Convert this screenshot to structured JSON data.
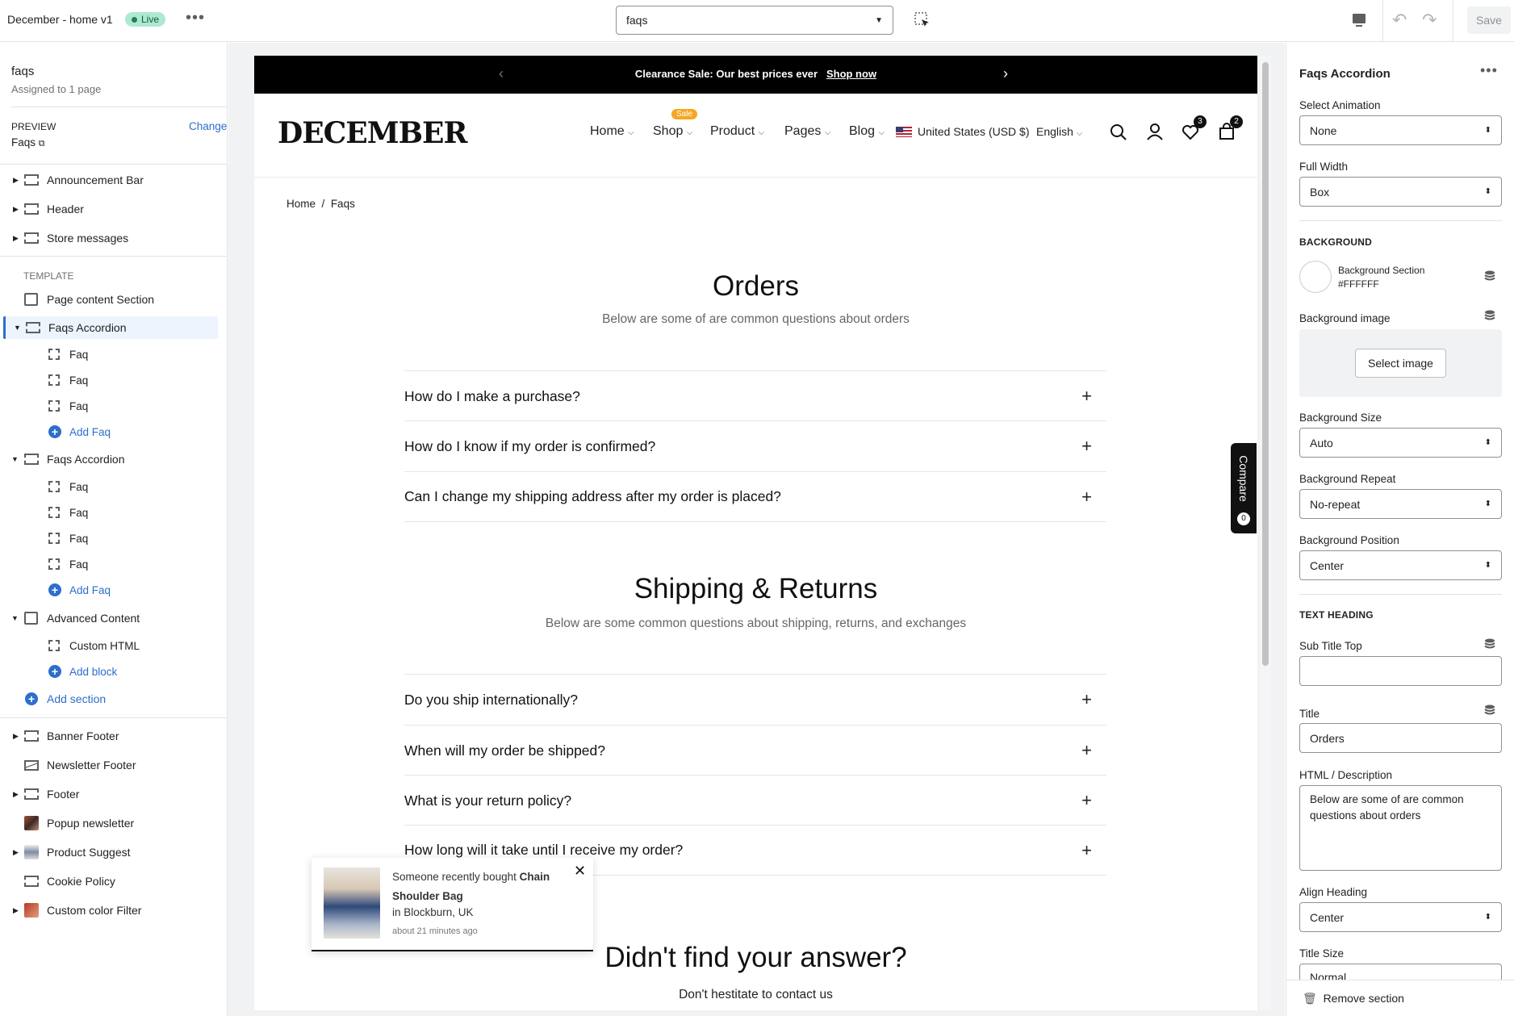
{
  "topbar": {
    "theme_name": "December - home v1",
    "live_label": "Live",
    "template_select": "faqs",
    "save_label": "Save"
  },
  "left": {
    "template_name": "faqs",
    "assigned": "Assigned to 1 page",
    "preview_label": "PREVIEW",
    "preview_value": "Faqs",
    "change_label": "Change",
    "header_sections": [
      "Announcement Bar",
      "Header",
      "Store messages"
    ],
    "template_heading": "TEMPLATE",
    "page_content": "Page content Section",
    "faqs_accordion_1": "Faqs Accordion",
    "faq_label": "Faq",
    "add_faq": "Add Faq",
    "faqs_accordion_2": "Faqs Accordion",
    "advanced_content": "Advanced Content",
    "custom_html": "Custom HTML",
    "add_block": "Add block",
    "add_section": "Add section",
    "footer_sections": [
      "Banner Footer",
      "Newsletter Footer",
      "Footer",
      "Popup newsletter",
      "Product Suggest",
      "Cookie Policy",
      "Custom color Filter"
    ]
  },
  "store": {
    "announcement": "Clearance Sale: Our best prices ever",
    "shop_now": "Shop now",
    "logo": "DECEMBER",
    "nav": [
      "Home",
      "Shop",
      "Product",
      "Pages",
      "Blog"
    ],
    "sale_badge": "Sale",
    "currency": "United States (USD $)",
    "language": "English",
    "wishlist_count": "3",
    "cart_count": "2",
    "breadcrumb_home": "Home",
    "breadcrumb_sep": "/",
    "breadcrumb_current": "Faqs",
    "orders_title": "Orders",
    "orders_sub": "Below are some of are common questions about orders",
    "orders_faqs": [
      "How do I make a purchase?",
      "How do I know if my order is confirmed?",
      "Can I change my shipping address after my order is placed?"
    ],
    "shipping_title": "Shipping & Returns",
    "shipping_sub": "Below are some common questions about shipping, returns, and exchanges",
    "shipping_faqs": [
      "Do you ship internationally?",
      "When will my order be shipped?",
      "What is your return policy?",
      "How long will it take until I receive my order?"
    ],
    "compare_label": "Compare",
    "compare_count": "0",
    "popup_text": "Someone recently bought",
    "popup_product": "Chain Shoulder Bag",
    "popup_location": "in Blockburn, UK",
    "popup_time": "about 21 minutes ago",
    "contact_title": "Didn't find your answer?",
    "contact_sub": "Don't hestitate to contact us"
  },
  "right": {
    "title": "Faqs Accordion",
    "select_animation_label": "Select Animation",
    "select_animation_value": "None",
    "full_width_label": "Full Width",
    "full_width_value": "Box",
    "background_heading": "BACKGROUND",
    "bg_section_label": "Background Section",
    "bg_section_value": "#FFFFFF",
    "bg_image_label": "Background image",
    "select_image": "Select image",
    "bg_size_label": "Background Size",
    "bg_size_value": "Auto",
    "bg_repeat_label": "Background Repeat",
    "bg_repeat_value": "No-repeat",
    "bg_position_label": "Background Position",
    "bg_position_value": "Center",
    "text_heading": "TEXT HEADING",
    "sub_title_label": "Sub Title Top",
    "sub_title_value": "",
    "title_label": "Title",
    "title_value": "Orders",
    "html_label": "HTML / Description",
    "html_value": "Below are some of are common questions about orders",
    "align_label": "Align Heading",
    "align_value": "Center",
    "title_size_label": "Title Size",
    "title_size_value": "Normal",
    "remove_section": "Remove section"
  }
}
